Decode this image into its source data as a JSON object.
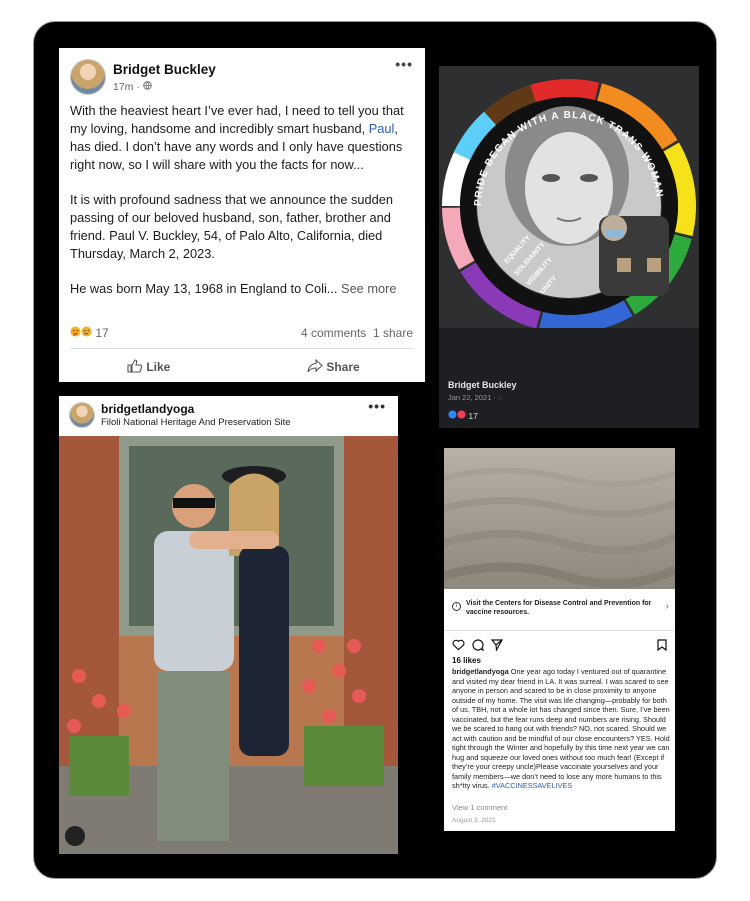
{
  "fb_post": {
    "author": "Bridget Buckley",
    "time": "17m · ",
    "more_label": "•••",
    "p1_before": "With the heaviest heart I’ve ever had, I need to tell you that my loving, handsome and incredibly smart husband, ",
    "p1_link": "Paul",
    "p1_after": ", has died. I don’t have any words and I only have questions right now, so I will share with you the facts for now...",
    "p2": "It is with profound sadness that we announce the sudden passing of our beloved husband, son, father, brother and friend.   Paul V. Buckley, 54, of Palo Alto, California, died Thursday, March 2, 2023.",
    "p3": "He was born May 13, 1968 in England to Coli... ",
    "see_more": "See more",
    "reaction_count": "17",
    "comments": "4 comments",
    "shares": "1 share",
    "like_label": "Like",
    "share_label": "Share"
  },
  "pride_card": {
    "ring_text": "PRIDE BEGAN WITH A BLACK TRANS WOMAN",
    "inner_words": [
      "EQUALITY",
      "SOLIDARITY",
      "VISIBILITY",
      "UNITY"
    ],
    "author": "Bridget Buckley",
    "date": "Jan 22, 2021 · ",
    "reaction_count": "17"
  },
  "ig_post": {
    "handle": "bridgetlandyoga",
    "location": "Filoli National Heritage And Preservation Site",
    "more_label": "•••"
  },
  "ig_post2": {
    "notice": "Visit the Centers for Disease Control and Prevention for vaccine resources.",
    "likes": "16 likes",
    "handle": "bridgetlandyoga",
    "caption": " One year ago today I ventured out of quarantine and visited my dear friend in LA. It was surreal. I was scared to see anyone in person and scared to be in close proximity to anyone outside of my home. The visit was life changing—probably for both of us. TBH, not a whole lot has changed since then. Sure, I’ve been vaccinated, but the fear runs deep and numbers are rising. Should we be scared to hang out with friends? NO, not scared. Should we act with caution and be mindful of our close encounters? YES. Hold tight through the Winter and hopefully by this time next year we can hug and squeeze our loved ones without too much fear! (Except if they’re your creepy uncle)Please vaccinate yourselves and your family members—we don’t need to lose any more humans to this sh*tty virus. ",
    "hashtag": "#VACCINESSAVELIVES",
    "comments": "View 1 comment",
    "date": "August 3, 2021"
  },
  "colors": {
    "background": "#000000",
    "fb_link": "#2b5fb8",
    "dark_card": "#1e1f22"
  }
}
